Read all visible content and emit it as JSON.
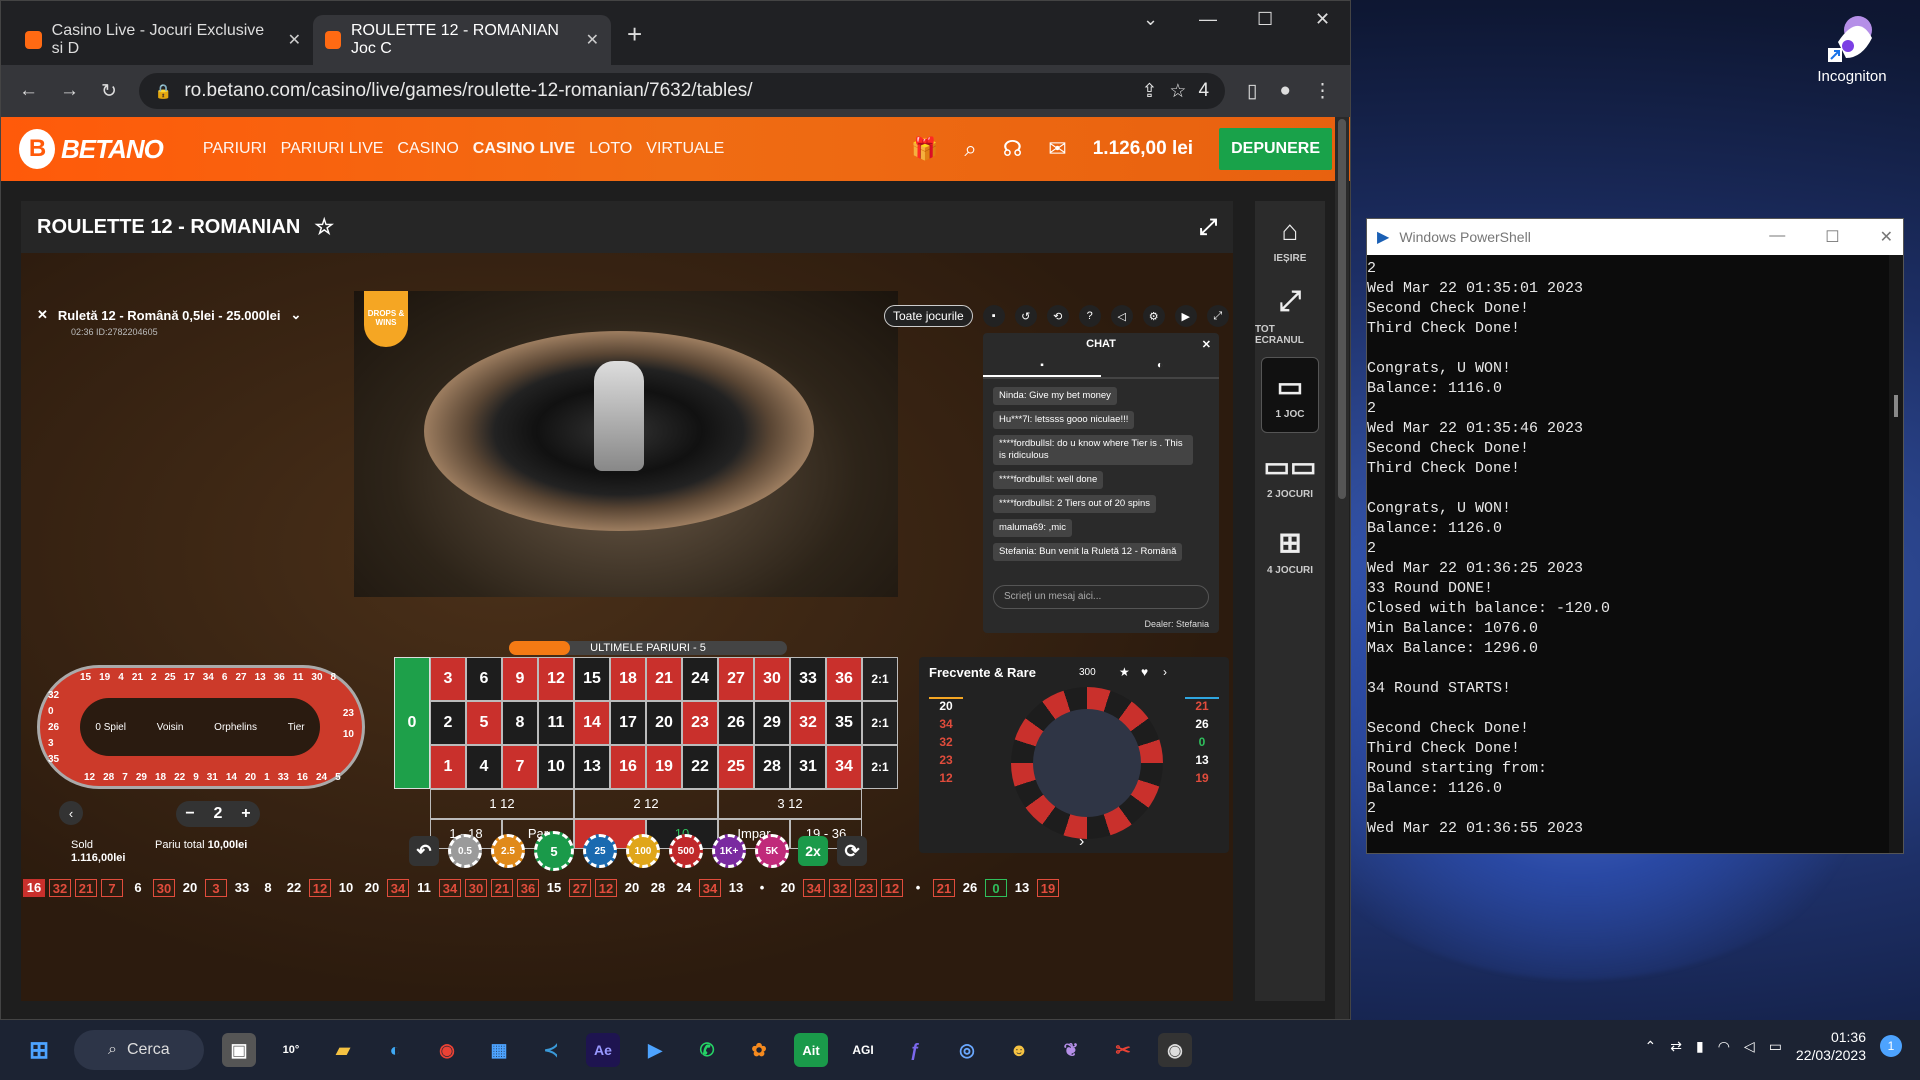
{
  "desktop": {
    "icon_label": "Incogniton"
  },
  "browser": {
    "tabs": [
      {
        "title": "Casino Live - Jocuri Exclusive si D"
      },
      {
        "title": "ROULETTE 12 - ROMANIAN Joc C"
      }
    ],
    "url": "ro.betano.com/casino/live/games/roulette-12-romanian/7632/tables/",
    "extensions_badge": "4"
  },
  "site": {
    "logo": "BETANO",
    "nav": [
      "PARIURI",
      "PARIURI LIVE",
      "CASINO",
      "CASINO LIVE",
      "LOTO",
      "VIRTUALE"
    ],
    "balance": "1.126,00 lei",
    "deposit_label": "DEPUNERE",
    "game_title": "ROULETTE 12 - ROMANIAN",
    "sidebar": [
      {
        "label": "IEȘIRE",
        "icon": "home-icon"
      },
      {
        "label": "TOT ECRANUL",
        "icon": "fullscreen-icon"
      },
      {
        "label": "1 JOC",
        "icon": "single-view-icon"
      },
      {
        "label": "2 JOCURI",
        "icon": "dual-view-icon"
      },
      {
        "label": "4 JOCURI",
        "icon": "quad-view-icon"
      }
    ]
  },
  "game": {
    "table_name": "Ruletă 12 - Română 0,5lei - 25.000lei",
    "table_sub": "02:36 ID:2782204605",
    "badge": "DROPS & WINS",
    "all_games_label": "Toate jocurile",
    "chat": {
      "title": "CHAT",
      "messages": [
        "Ninda: Give my bet money",
        "Hu***7l: letssss gooo niculae!!!",
        "****fordbullsl: do u know where Tier is . This is ridiculous",
        "****fordbullsl: well done",
        "****fordbullsl: 2 Tiers out of 20 spins",
        "maluma69: ,mic",
        "Stefania: Bun venit la Ruletă 12 - Română"
      ],
      "input_placeholder": "Scrieți un mesaj aici...",
      "dealer": "Dealer: Stefania"
    },
    "last_bets_label": "ULTIMELE PARIURI - 5",
    "last_bets_progress": 0.22,
    "racetrack": {
      "sections": [
        "0 Spiel",
        "Voisin",
        "Orphelins",
        "Tier"
      ],
      "top": [
        "15",
        "19",
        "4",
        "21",
        "2",
        "25",
        "17",
        "34",
        "6",
        "27",
        "13",
        "36",
        "11",
        "30",
        "8"
      ],
      "bottom": [
        "12",
        "28",
        "7",
        "29",
        "18",
        "22",
        "9",
        "31",
        "14",
        "20",
        "1",
        "33",
        "16",
        "24",
        "5"
      ],
      "left": [
        "32",
        "0",
        "26",
        "3",
        "35"
      ],
      "right": [
        "23",
        "10"
      ]
    },
    "board": {
      "zero": "0",
      "rows": [
        [
          "3",
          "6",
          "9",
          "12",
          "15",
          "18",
          "21",
          "24",
          "27",
          "30",
          "33",
          "36",
          "2:1"
        ],
        [
          "2",
          "5",
          "8",
          "11",
          "14",
          "17",
          "20",
          "23",
          "26",
          "29",
          "32",
          "35",
          "2:1"
        ],
        [
          "1",
          "4",
          "7",
          "10",
          "13",
          "16",
          "19",
          "22",
          "25",
          "28",
          "31",
          "34",
          "2:1"
        ]
      ],
      "row_colors": [
        [
          "r",
          "b",
          "r",
          "r",
          "b",
          "r",
          "r",
          "b",
          "r",
          "r",
          "b",
          "r",
          "k"
        ],
        [
          "b",
          "r",
          "b",
          "b",
          "r",
          "b",
          "b",
          "r",
          "b",
          "b",
          "r",
          "b",
          "k"
        ],
        [
          "r",
          "b",
          "r",
          "b",
          "b",
          "r",
          "r",
          "b",
          "r",
          "b",
          "b",
          "r",
          "k"
        ]
      ],
      "dozens": [
        "1 12",
        "2 12",
        "3 12"
      ],
      "outside": [
        "1 - 18",
        "Par",
        "",
        "10",
        "Impar",
        "19 - 36"
      ]
    },
    "bet_multiplier": "2",
    "chips": [
      "0.5",
      "2.5",
      "5",
      "25",
      "100",
      "500",
      "1K+",
      "5K"
    ],
    "double_label": "2x",
    "sold_label": "Sold",
    "sold_value": "1.116,00lei",
    "total_label": "Pariu total",
    "total_value": "10,00lei",
    "history": [
      {
        "n": "16",
        "c": "rr"
      },
      {
        "n": "32",
        "c": "r"
      },
      {
        "n": "21",
        "c": "r"
      },
      {
        "n": "7",
        "c": "r"
      },
      {
        "n": "6",
        "c": "w"
      },
      {
        "n": "30",
        "c": "r"
      },
      {
        "n": "20",
        "c": "w"
      },
      {
        "n": "3",
        "c": "r"
      },
      {
        "n": "33",
        "c": "w"
      },
      {
        "n": "8",
        "c": "w"
      },
      {
        "n": "22",
        "c": "w"
      },
      {
        "n": "12",
        "c": "r"
      },
      {
        "n": "10",
        "c": "w"
      },
      {
        "n": "20",
        "c": "w"
      },
      {
        "n": "34",
        "c": "r"
      },
      {
        "n": "11",
        "c": "w"
      },
      {
        "n": "34",
        "c": "r"
      },
      {
        "n": "30",
        "c": "r"
      },
      {
        "n": "21",
        "c": "r"
      },
      {
        "n": "36",
        "c": "r"
      },
      {
        "n": "15",
        "c": "w"
      },
      {
        "n": "27",
        "c": "r"
      },
      {
        "n": "12",
        "c": "r"
      },
      {
        "n": "20",
        "c": "w"
      },
      {
        "n": "28",
        "c": "w"
      },
      {
        "n": "24",
        "c": "w"
      },
      {
        "n": "34",
        "c": "r"
      },
      {
        "n": "13",
        "c": "w"
      },
      {
        "n": "•",
        "c": "w"
      },
      {
        "n": "20",
        "c": "w"
      },
      {
        "n": "34",
        "c": "r"
      },
      {
        "n": "32",
        "c": "r"
      },
      {
        "n": "23",
        "c": "r"
      },
      {
        "n": "12",
        "c": "r"
      },
      {
        "n": "•",
        "c": "w"
      },
      {
        "n": "21",
        "c": "r"
      },
      {
        "n": "26",
        "c": "w"
      },
      {
        "n": "0",
        "c": "g"
      },
      {
        "n": "13",
        "c": "w"
      },
      {
        "n": "19",
        "c": "r"
      }
    ],
    "stats": {
      "title": "Frecvente & Rare",
      "spins": "300",
      "hot": [
        "20",
        "34",
        "32",
        "23",
        "12"
      ],
      "cold": [
        "21",
        "26",
        "0",
        "13",
        "19"
      ]
    }
  },
  "powershell": {
    "title": "Windows PowerShell",
    "lines": [
      "2",
      "Wed Mar 22 01:35:01 2023",
      "Second Check Done!",
      "Third Check Done!",
      "",
      "Congrats, U WON!",
      "Balance: 1116.0",
      "2",
      "Wed Mar 22 01:35:46 2023",
      "Second Check Done!",
      "Third Check Done!",
      "",
      "Congrats, U WON!",
      "Balance: 1126.0",
      "2",
      "Wed Mar 22 01:36:25 2023",
      "33 Round DONE!",
      "Closed with balance: -120.0",
      "Min Balance: 1076.0",
      "Max Balance: 1296.0",
      "",
      "34 Round STARTS!",
      "",
      "Second Check Done!",
      "Third Check Done!",
      "Round starting from:",
      "Balance: 1126.0",
      "2",
      "Wed Mar 22 01:36:55 2023"
    ]
  },
  "taskbar": {
    "search_label": "Cerca",
    "weather": "10°",
    "apps": [
      "task-view",
      "weather",
      "file-explorer",
      "edge",
      "chrome",
      "store",
      "vscode",
      "after-effects",
      "powershell",
      "whatsapp",
      "fl-studio",
      "ait",
      "agi",
      "teams",
      "chrome-2",
      "smile",
      "incogniton",
      "snipping",
      "obs"
    ],
    "time": "01:36",
    "date": "22/03/2023",
    "notifications": "1"
  }
}
